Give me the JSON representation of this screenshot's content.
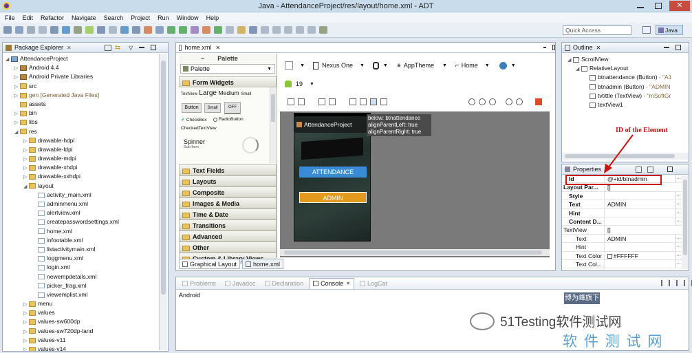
{
  "window": {
    "title": "Java - AttendanceProject/res/layout/home.xml - ADT"
  },
  "menu": [
    "File",
    "Edit",
    "Refactor",
    "Navigate",
    "Search",
    "Project",
    "Run",
    "Window",
    "Help"
  ],
  "quick_access": {
    "placeholder": "Quick Access",
    "perspective": "Java"
  },
  "package_explorer": {
    "title": "Package Explorer",
    "items": [
      {
        "label": "AttendanceProject",
        "depth": 0,
        "icon": "project",
        "arrow": "open"
      },
      {
        "label": "Android 4.4",
        "depth": 1,
        "icon": "lib",
        "arrow": "closed"
      },
      {
        "label": "Android Private Libraries",
        "depth": 1,
        "icon": "lib",
        "arrow": "closed"
      },
      {
        "label": "src",
        "depth": 1,
        "icon": "folder",
        "arrow": "closed"
      },
      {
        "label": "gen [Generated Java Files]",
        "depth": 1,
        "icon": "folder",
        "arrow": "closed"
      },
      {
        "label": "assets",
        "depth": 1,
        "icon": "folder",
        "arrow": "none"
      },
      {
        "label": "bin",
        "depth": 1,
        "icon": "folder",
        "arrow": "closed"
      },
      {
        "label": "libs",
        "depth": 1,
        "icon": "folder",
        "arrow": "closed"
      },
      {
        "label": "res",
        "depth": 1,
        "icon": "folder",
        "arrow": "open"
      },
      {
        "label": "drawable-hdpi",
        "depth": 2,
        "icon": "folder",
        "arrow": "closed"
      },
      {
        "label": "drawable-ldpi",
        "depth": 2,
        "icon": "folder",
        "arrow": "closed"
      },
      {
        "label": "drawable-mdpi",
        "depth": 2,
        "icon": "folder",
        "arrow": "closed"
      },
      {
        "label": "drawable-xhdpi",
        "depth": 2,
        "icon": "folder",
        "arrow": "closed"
      },
      {
        "label": "drawable-xxhdpi",
        "depth": 2,
        "icon": "folder",
        "arrow": "closed"
      },
      {
        "label": "layout",
        "depth": 2,
        "icon": "folder",
        "arrow": "open"
      },
      {
        "label": "activity_main.xml",
        "depth": 3,
        "icon": "xml",
        "arrow": "none"
      },
      {
        "label": "adminmenu.xml",
        "depth": 3,
        "icon": "xml",
        "arrow": "none"
      },
      {
        "label": "alertview.xml",
        "depth": 3,
        "icon": "xml",
        "arrow": "none"
      },
      {
        "label": "createpasswordsettings.xml",
        "depth": 3,
        "icon": "xml",
        "arrow": "none"
      },
      {
        "label": "home.xml",
        "depth": 3,
        "icon": "xml",
        "arrow": "none"
      },
      {
        "label": "infootable.xml",
        "depth": 3,
        "icon": "xml",
        "arrow": "none"
      },
      {
        "label": "listactivitymain.xml",
        "depth": 3,
        "icon": "xml",
        "arrow": "none"
      },
      {
        "label": "loggmenu.xml",
        "depth": 3,
        "icon": "xml",
        "arrow": "none"
      },
      {
        "label": "login.xml",
        "depth": 3,
        "icon": "xml",
        "arrow": "none"
      },
      {
        "label": "newempdetails.xml",
        "depth": 3,
        "icon": "xml",
        "arrow": "none"
      },
      {
        "label": "picker_frag.xml",
        "depth": 3,
        "icon": "xml",
        "arrow": "none"
      },
      {
        "label": "viewemplist.xml",
        "depth": 3,
        "icon": "xml",
        "arrow": "none"
      },
      {
        "label": "menu",
        "depth": 2,
        "icon": "folder",
        "arrow": "closed"
      },
      {
        "label": "values",
        "depth": 2,
        "icon": "folder",
        "arrow": "closed"
      },
      {
        "label": "values-sw600dp",
        "depth": 2,
        "icon": "folder",
        "arrow": "closed"
      },
      {
        "label": "values-sw720dp-land",
        "depth": 2,
        "icon": "folder",
        "arrow": "closed"
      },
      {
        "label": "values-v11",
        "depth": 2,
        "icon": "folder",
        "arrow": "closed"
      },
      {
        "label": "values-v14",
        "depth": 2,
        "icon": "folder",
        "arrow": "closed"
      }
    ]
  },
  "editor": {
    "tab": "home.xml",
    "palette": {
      "title": "Palette",
      "dropdown": "Palette",
      "form_widgets": "Form Widgets",
      "tv_small_label": "TextView",
      "tv_large": "Large",
      "tv_medium": "Medium",
      "tv_small": "Small",
      "btn_button": "Button",
      "btn_small": "Small",
      "btn_off": "OFF",
      "checkbox": "CheckBox",
      "radio": "RadioButton",
      "checked_tv": "CheckedTextView",
      "spinner": "Spinner",
      "spinner_sub": "Sub Item",
      "categories": [
        "Text Fields",
        "Layouts",
        "Composite",
        "Images & Media",
        "Time & Date",
        "Transitions",
        "Advanced",
        "Other",
        "Custom & Library Views"
      ]
    },
    "config": {
      "device": "Nexus One",
      "theme": "AppTheme",
      "activity": "Home",
      "api": "19"
    },
    "preview": {
      "app_title": "AttendanceProject",
      "attendance_btn": "ATTENDANCE",
      "admin_btn": "ADMIN",
      "tooltip": [
        "below: btnattendance",
        "alignParentLeft: true",
        "alignParentRight: true"
      ]
    },
    "bottom_tabs": [
      "Graphical Layout",
      "home.xml"
    ]
  },
  "outline": {
    "title": "Outline",
    "items": [
      {
        "label": "ScrollView",
        "extra": "",
        "depth": 0
      },
      {
        "label": "RelativeLayout",
        "extra": "",
        "depth": 1
      },
      {
        "label": "btnattendance (Button)",
        "extra": " - \"A1",
        "depth": 2
      },
      {
        "label": "btnadmin (Button)",
        "extra": " - \"ADMIN",
        "depth": 2
      },
      {
        "label": "tvtittle (TextView)",
        "extra": " - \"mSoftGr",
        "depth": 2
      },
      {
        "label": "textView1",
        "extra": "",
        "depth": 2
      }
    ]
  },
  "properties": {
    "title": "Properties",
    "annotation": "ID of the Element",
    "rows": [
      {
        "key": "Id",
        "value": "@+id/btnadmin",
        "dots": true
      },
      {
        "key": "Layout Par...",
        "value": "[]",
        "dots": false
      },
      {
        "key": "Style",
        "value": "",
        "dots": true
      },
      {
        "key": "Text",
        "value": "ADMIN",
        "dots": true
      },
      {
        "key": "Hint",
        "value": "",
        "dots": true
      },
      {
        "key": "Content D...",
        "value": "",
        "dots": true
      },
      {
        "key": "TextView",
        "value": "[]",
        "dots": false
      },
      {
        "key": "Text",
        "value": "ADMIN",
        "dots": true
      },
      {
        "key": "Hint",
        "value": "",
        "dots": true
      },
      {
        "key": "Text Color",
        "value": "#FFFFFF",
        "dots": true
      },
      {
        "key": "Text Col...",
        "value": "",
        "dots": true
      }
    ]
  },
  "console": {
    "tabs": [
      "Problems",
      "Javadoc",
      "Declaration",
      "Console",
      "LogCat"
    ],
    "content": "Android"
  },
  "watermark": {
    "stamp": "博为峰旗下",
    "site": "51Testing软件测试网",
    "big": "软 件 测 试 网"
  },
  "colors": {
    "attendance": "#3a8bd6",
    "admin": "#e39a1c",
    "annotation": "#cc1111"
  }
}
